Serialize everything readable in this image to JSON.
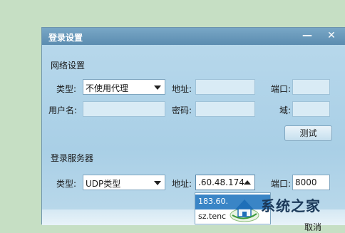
{
  "dialog": {
    "title": "登录设置",
    "minimize_glyph": "—",
    "close_glyph": "✕"
  },
  "network": {
    "section_title": "网络设置",
    "type_label": "类型:",
    "type_value": "不使用代理",
    "address_label": "地址:",
    "port_label": "端口:",
    "username_label": "用户名:",
    "password_label": "密码:",
    "domain_label": "域:",
    "test_button": "测试"
  },
  "server": {
    "section_title": "登录服务器",
    "type_label": "类型:",
    "type_value": "UDP类型",
    "address_label": "地址:",
    "address_value": ".60.48.174",
    "port_label": "端口:",
    "port_value": "8000",
    "dropdown_items": [
      "183.60.",
      "sz.tenc"
    ]
  },
  "footer": {
    "cancel_label": "取消"
  },
  "watermark": {
    "text": "系统之家",
    "icon": "house-logo-icon"
  },
  "colors": {
    "titlebar": "#5b8cb0",
    "dialog_bg": "#a9cfe6",
    "selection": "#3a85c6",
    "desktop": "#c6dfc4"
  }
}
